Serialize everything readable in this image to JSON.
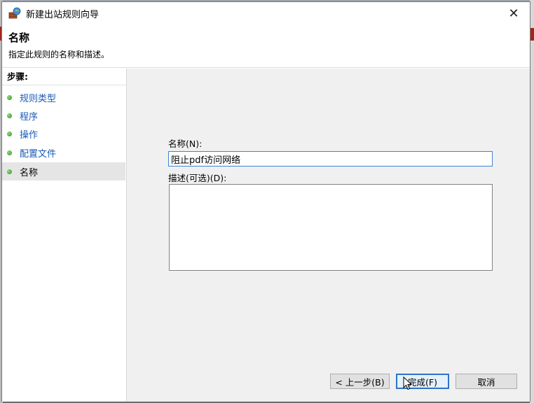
{
  "window": {
    "title": "新建出站规则向导",
    "close_glyph": "✕"
  },
  "header": {
    "title": "名称",
    "subtitle": "指定此规则的名称和描述。"
  },
  "steps": {
    "title": "步骤:",
    "items": [
      {
        "label": "规则类型",
        "active": false
      },
      {
        "label": "程序",
        "active": false
      },
      {
        "label": "操作",
        "active": false
      },
      {
        "label": "配置文件",
        "active": false
      },
      {
        "label": "名称",
        "active": true
      }
    ]
  },
  "form": {
    "name_label": "名称(N):",
    "name_value": "阻止pdf访问网络",
    "description_label": "描述(可选)(D):",
    "description_value": ""
  },
  "buttons": {
    "back": "< 上一步(B)",
    "finish": "完成(F)",
    "cancel": "取消"
  },
  "colors": {
    "link": "#1a5bb5",
    "focus": "#3c84d6",
    "step_dot": "#2e8f1f"
  },
  "icons": {
    "title": "firewall-wizard-icon",
    "step": "green-dot-icon",
    "cursor": "mouse-pointer-icon"
  }
}
